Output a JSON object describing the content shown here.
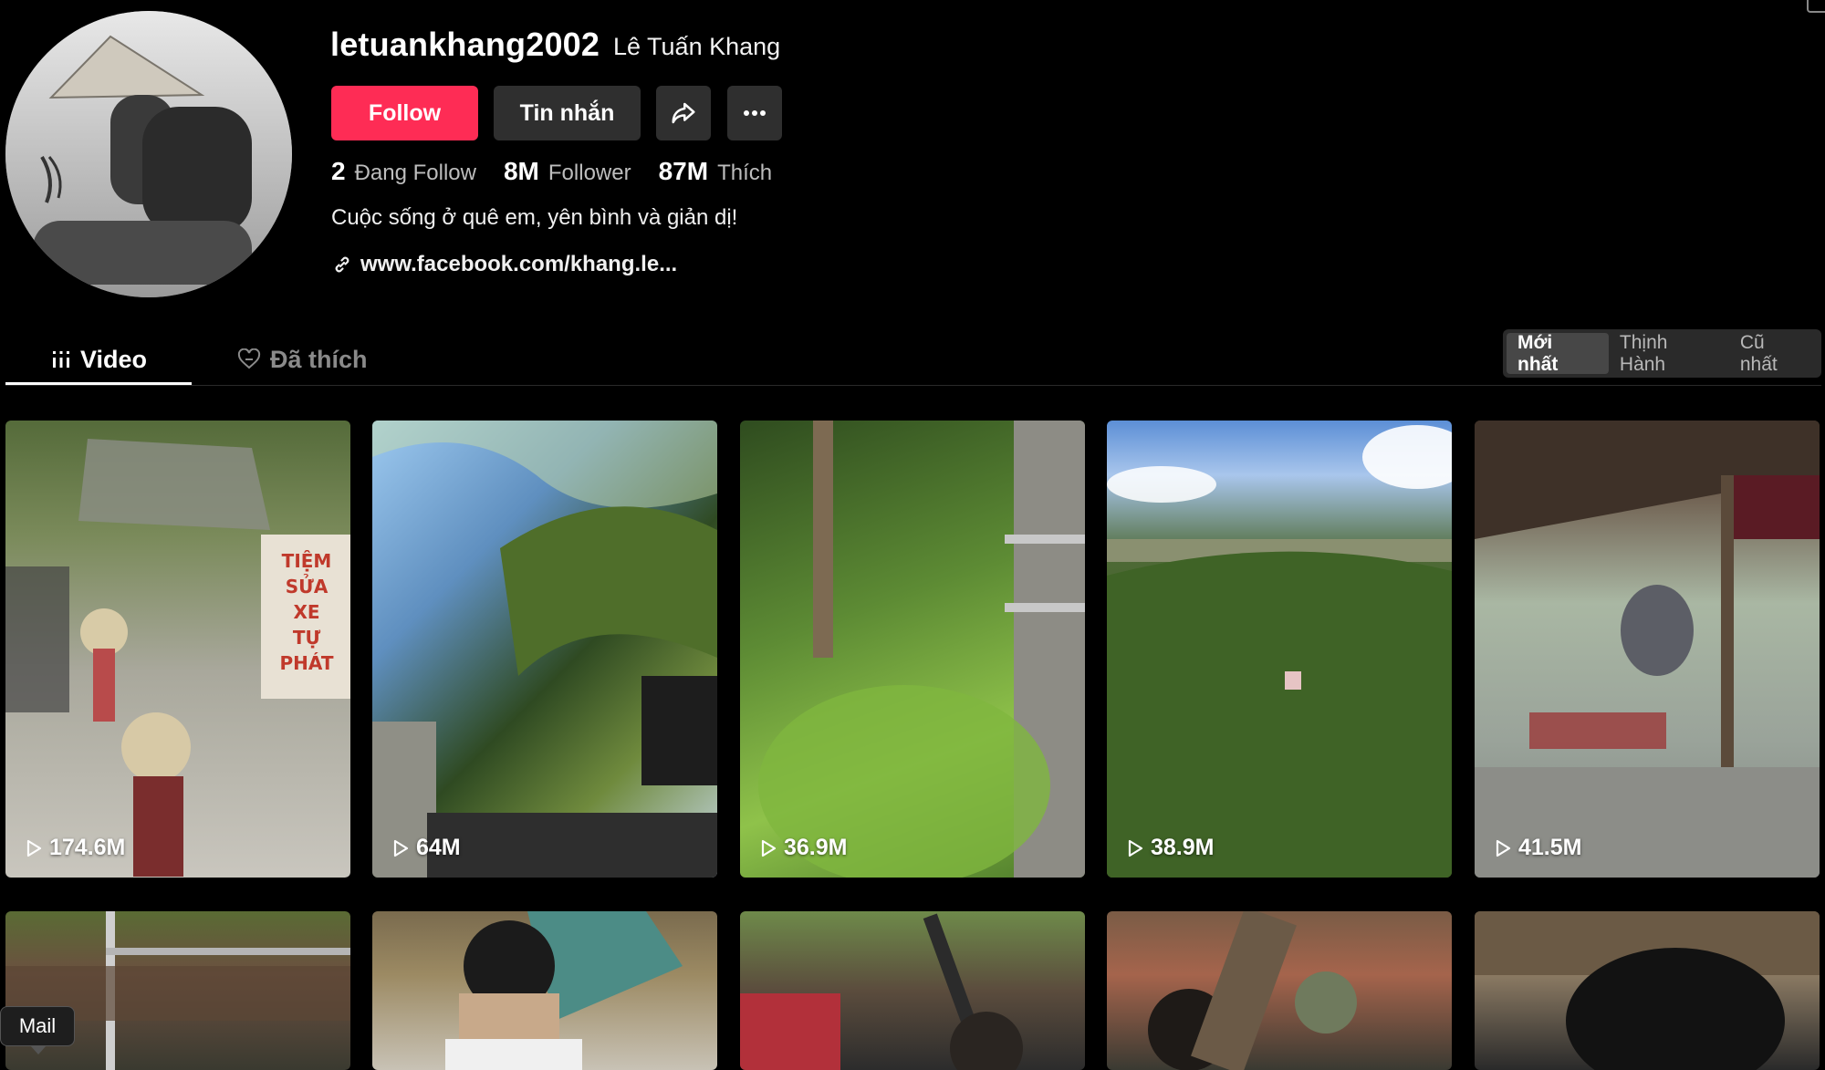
{
  "profile": {
    "username": "letuankhang2002",
    "full_name": "Lê Tuấn Khang",
    "follow_label": "Follow",
    "message_label": "Tin nhắn",
    "stats": [
      {
        "value": "2",
        "label": "Đang Follow"
      },
      {
        "value": "8M",
        "label": "Follower"
      },
      {
        "value": "87M",
        "label": "Thích"
      }
    ],
    "bio": "Cuộc sống ở quê em, yên bình và giản dị!",
    "link": "www.facebook.com/khang.le..."
  },
  "tabs": {
    "video": "Video",
    "liked": "Đã thích"
  },
  "sort": {
    "options": [
      "Mới nhất",
      "Thịnh Hành",
      "Cũ nhất"
    ],
    "active": "Mới nhất"
  },
  "videos": [
    {
      "views": "174.6M",
      "sign_lines": [
        "TIỆM",
        "SỬA",
        "XE",
        "TỰ",
        "PHÁT"
      ]
    },
    {
      "views": "64M"
    },
    {
      "views": "36.9M"
    },
    {
      "views": "38.9M"
    },
    {
      "views": "41.5M"
    },
    {
      "views": ""
    },
    {
      "views": ""
    },
    {
      "views": ""
    },
    {
      "views": ""
    },
    {
      "views": ""
    }
  ],
  "tooltip": {
    "mail": "Mail"
  },
  "colors": {
    "background": "#000000",
    "follow_button": "#fe2c55",
    "secondary_button": "#2f2f2f",
    "muted_text": "#8a8a8a"
  },
  "icons": [
    "link-icon",
    "share-icon",
    "more-icon",
    "grid-icon",
    "liked-heart-icon",
    "play-icon"
  ]
}
